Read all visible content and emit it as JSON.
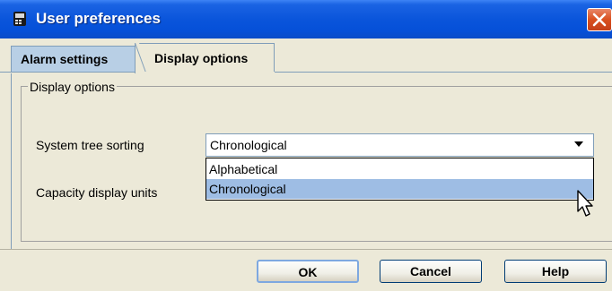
{
  "window": {
    "title": "User preferences",
    "close_icon": "close-icon",
    "app_icon": "app-icon"
  },
  "tabs": [
    {
      "label": "Alarm settings",
      "active": false
    },
    {
      "label": "Display options",
      "active": true
    }
  ],
  "group": {
    "legend": "Display options"
  },
  "fields": {
    "sort_label": "System tree sorting",
    "sort_value": "Chronological",
    "capacity_label": "Capacity display units"
  },
  "dropdown": {
    "options": [
      "Alphabetical",
      "Chronological"
    ],
    "highlighted": "Chronological"
  },
  "buttons": {
    "ok": "OK",
    "cancel": "Cancel",
    "help": "Help"
  },
  "colors": {
    "title_bar": "#0a55db",
    "highlight": "#9ebde4",
    "window_bg": "#ece9d8"
  }
}
